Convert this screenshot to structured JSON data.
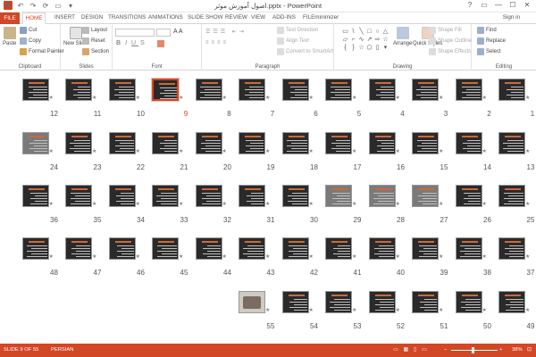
{
  "titlebar": {
    "title": "اصول آموزش موثر.pptx - PowerPoint",
    "quick_access": [
      "P",
      "↶",
      "↷",
      "⟳",
      "▭",
      "▾"
    ],
    "controls": [
      "?",
      "▭",
      "—",
      "☐",
      "✕"
    ]
  },
  "tabs": {
    "file": "FILE",
    "home": "HOME",
    "items": [
      "INSERT",
      "DESIGN",
      "TRANSITIONS",
      "ANIMATIONS",
      "SLIDE SHOW",
      "REVIEW",
      "VIEW",
      "ADD-INS",
      "FILEminimizer"
    ],
    "sign_in": "Sign in"
  },
  "ribbon": {
    "clipboard": {
      "paste": "Paste",
      "cut": "Cut",
      "copy": "Copy",
      "format_painter": "Format Painter",
      "label": "Clipboard"
    },
    "slides": {
      "new_slide": "New Slide",
      "layout": "Layout",
      "reset": "Reset",
      "section": "Section",
      "label": "Slides"
    },
    "font": {
      "label": "Font"
    },
    "paragraph": {
      "text_direction": "Text Direction",
      "align_text": "Align Text",
      "convert": "Convert to SmartArt",
      "label": "Paragraph"
    },
    "drawing": {
      "arrange": "Arrange",
      "quick_styles": "Quick Styles",
      "shape_fill": "Shape Fill",
      "shape_outline": "Shape Outline",
      "shape_effects": "Shape Effects",
      "label": "Drawing"
    },
    "editing": {
      "find": "Find",
      "replace": "Replace",
      "select": "Select",
      "label": "Editing"
    }
  },
  "slides": [
    {
      "n": "1"
    },
    {
      "n": "2"
    },
    {
      "n": "3"
    },
    {
      "n": "4"
    },
    {
      "n": "5"
    },
    {
      "n": "6"
    },
    {
      "n": "7"
    },
    {
      "n": "8"
    },
    {
      "n": "9"
    },
    {
      "n": "10"
    },
    {
      "n": "11"
    },
    {
      "n": "12"
    },
    {
      "n": "13"
    },
    {
      "n": "14"
    },
    {
      "n": "15"
    },
    {
      "n": "16"
    },
    {
      "n": "17"
    },
    {
      "n": "18"
    },
    {
      "n": "19"
    },
    {
      "n": "20"
    },
    {
      "n": "21"
    },
    {
      "n": "22"
    },
    {
      "n": "23"
    },
    {
      "n": "24"
    },
    {
      "n": "25"
    },
    {
      "n": "26"
    },
    {
      "n": "27"
    },
    {
      "n": "28"
    },
    {
      "n": "29"
    },
    {
      "n": "30"
    },
    {
      "n": "31"
    },
    {
      "n": "32"
    },
    {
      "n": "33"
    },
    {
      "n": "34"
    },
    {
      "n": "35"
    },
    {
      "n": "36"
    },
    {
      "n": "37"
    },
    {
      "n": "38"
    },
    {
      "n": "39"
    },
    {
      "n": "40"
    },
    {
      "n": "41"
    },
    {
      "n": "42"
    },
    {
      "n": "43"
    },
    {
      "n": "44"
    },
    {
      "n": "45"
    },
    {
      "n": "46"
    },
    {
      "n": "47"
    },
    {
      "n": "48"
    },
    {
      "n": "49"
    },
    {
      "n": "50"
    },
    {
      "n": "51"
    },
    {
      "n": "52"
    },
    {
      "n": "53"
    },
    {
      "n": "54"
    },
    {
      "n": "55"
    }
  ],
  "selected_slide": "9",
  "status": {
    "slide_info": "SLIDE 9 OF 55",
    "language": "PERSIAN",
    "zoom": "38%"
  }
}
